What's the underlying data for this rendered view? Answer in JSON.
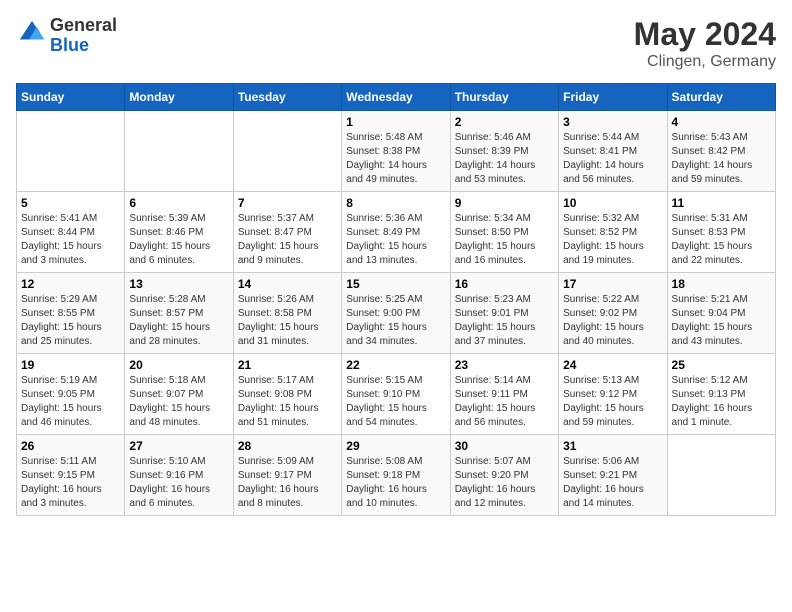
{
  "header": {
    "logo_line1": "General",
    "logo_line2": "Blue",
    "month": "May 2024",
    "location": "Clingen, Germany"
  },
  "days_of_week": [
    "Sunday",
    "Monday",
    "Tuesday",
    "Wednesday",
    "Thursday",
    "Friday",
    "Saturday"
  ],
  "weeks": [
    [
      {
        "day": "",
        "sunrise": "",
        "sunset": "",
        "daylight": ""
      },
      {
        "day": "",
        "sunrise": "",
        "sunset": "",
        "daylight": ""
      },
      {
        "day": "",
        "sunrise": "",
        "sunset": "",
        "daylight": ""
      },
      {
        "day": "1",
        "sunrise": "Sunrise: 5:48 AM",
        "sunset": "Sunset: 8:38 PM",
        "daylight": "Daylight: 14 hours and 49 minutes."
      },
      {
        "day": "2",
        "sunrise": "Sunrise: 5:46 AM",
        "sunset": "Sunset: 8:39 PM",
        "daylight": "Daylight: 14 hours and 53 minutes."
      },
      {
        "day": "3",
        "sunrise": "Sunrise: 5:44 AM",
        "sunset": "Sunset: 8:41 PM",
        "daylight": "Daylight: 14 hours and 56 minutes."
      },
      {
        "day": "4",
        "sunrise": "Sunrise: 5:43 AM",
        "sunset": "Sunset: 8:42 PM",
        "daylight": "Daylight: 14 hours and 59 minutes."
      }
    ],
    [
      {
        "day": "5",
        "sunrise": "Sunrise: 5:41 AM",
        "sunset": "Sunset: 8:44 PM",
        "daylight": "Daylight: 15 hours and 3 minutes."
      },
      {
        "day": "6",
        "sunrise": "Sunrise: 5:39 AM",
        "sunset": "Sunset: 8:46 PM",
        "daylight": "Daylight: 15 hours and 6 minutes."
      },
      {
        "day": "7",
        "sunrise": "Sunrise: 5:37 AM",
        "sunset": "Sunset: 8:47 PM",
        "daylight": "Daylight: 15 hours and 9 minutes."
      },
      {
        "day": "8",
        "sunrise": "Sunrise: 5:36 AM",
        "sunset": "Sunset: 8:49 PM",
        "daylight": "Daylight: 15 hours and 13 minutes."
      },
      {
        "day": "9",
        "sunrise": "Sunrise: 5:34 AM",
        "sunset": "Sunset: 8:50 PM",
        "daylight": "Daylight: 15 hours and 16 minutes."
      },
      {
        "day": "10",
        "sunrise": "Sunrise: 5:32 AM",
        "sunset": "Sunset: 8:52 PM",
        "daylight": "Daylight: 15 hours and 19 minutes."
      },
      {
        "day": "11",
        "sunrise": "Sunrise: 5:31 AM",
        "sunset": "Sunset: 8:53 PM",
        "daylight": "Daylight: 15 hours and 22 minutes."
      }
    ],
    [
      {
        "day": "12",
        "sunrise": "Sunrise: 5:29 AM",
        "sunset": "Sunset: 8:55 PM",
        "daylight": "Daylight: 15 hours and 25 minutes."
      },
      {
        "day": "13",
        "sunrise": "Sunrise: 5:28 AM",
        "sunset": "Sunset: 8:57 PM",
        "daylight": "Daylight: 15 hours and 28 minutes."
      },
      {
        "day": "14",
        "sunrise": "Sunrise: 5:26 AM",
        "sunset": "Sunset: 8:58 PM",
        "daylight": "Daylight: 15 hours and 31 minutes."
      },
      {
        "day": "15",
        "sunrise": "Sunrise: 5:25 AM",
        "sunset": "Sunset: 9:00 PM",
        "daylight": "Daylight: 15 hours and 34 minutes."
      },
      {
        "day": "16",
        "sunrise": "Sunrise: 5:23 AM",
        "sunset": "Sunset: 9:01 PM",
        "daylight": "Daylight: 15 hours and 37 minutes."
      },
      {
        "day": "17",
        "sunrise": "Sunrise: 5:22 AM",
        "sunset": "Sunset: 9:02 PM",
        "daylight": "Daylight: 15 hours and 40 minutes."
      },
      {
        "day": "18",
        "sunrise": "Sunrise: 5:21 AM",
        "sunset": "Sunset: 9:04 PM",
        "daylight": "Daylight: 15 hours and 43 minutes."
      }
    ],
    [
      {
        "day": "19",
        "sunrise": "Sunrise: 5:19 AM",
        "sunset": "Sunset: 9:05 PM",
        "daylight": "Daylight: 15 hours and 46 minutes."
      },
      {
        "day": "20",
        "sunrise": "Sunrise: 5:18 AM",
        "sunset": "Sunset: 9:07 PM",
        "daylight": "Daylight: 15 hours and 48 minutes."
      },
      {
        "day": "21",
        "sunrise": "Sunrise: 5:17 AM",
        "sunset": "Sunset: 9:08 PM",
        "daylight": "Daylight: 15 hours and 51 minutes."
      },
      {
        "day": "22",
        "sunrise": "Sunrise: 5:15 AM",
        "sunset": "Sunset: 9:10 PM",
        "daylight": "Daylight: 15 hours and 54 minutes."
      },
      {
        "day": "23",
        "sunrise": "Sunrise: 5:14 AM",
        "sunset": "Sunset: 9:11 PM",
        "daylight": "Daylight: 15 hours and 56 minutes."
      },
      {
        "day": "24",
        "sunrise": "Sunrise: 5:13 AM",
        "sunset": "Sunset: 9:12 PM",
        "daylight": "Daylight: 15 hours and 59 minutes."
      },
      {
        "day": "25",
        "sunrise": "Sunrise: 5:12 AM",
        "sunset": "Sunset: 9:13 PM",
        "daylight": "Daylight: 16 hours and 1 minute."
      }
    ],
    [
      {
        "day": "26",
        "sunrise": "Sunrise: 5:11 AM",
        "sunset": "Sunset: 9:15 PM",
        "daylight": "Daylight: 16 hours and 3 minutes."
      },
      {
        "day": "27",
        "sunrise": "Sunrise: 5:10 AM",
        "sunset": "Sunset: 9:16 PM",
        "daylight": "Daylight: 16 hours and 6 minutes."
      },
      {
        "day": "28",
        "sunrise": "Sunrise: 5:09 AM",
        "sunset": "Sunset: 9:17 PM",
        "daylight": "Daylight: 16 hours and 8 minutes."
      },
      {
        "day": "29",
        "sunrise": "Sunrise: 5:08 AM",
        "sunset": "Sunset: 9:18 PM",
        "daylight": "Daylight: 16 hours and 10 minutes."
      },
      {
        "day": "30",
        "sunrise": "Sunrise: 5:07 AM",
        "sunset": "Sunset: 9:20 PM",
        "daylight": "Daylight: 16 hours and 12 minutes."
      },
      {
        "day": "31",
        "sunrise": "Sunrise: 5:06 AM",
        "sunset": "Sunset: 9:21 PM",
        "daylight": "Daylight: 16 hours and 14 minutes."
      },
      {
        "day": "",
        "sunrise": "",
        "sunset": "",
        "daylight": ""
      }
    ]
  ]
}
